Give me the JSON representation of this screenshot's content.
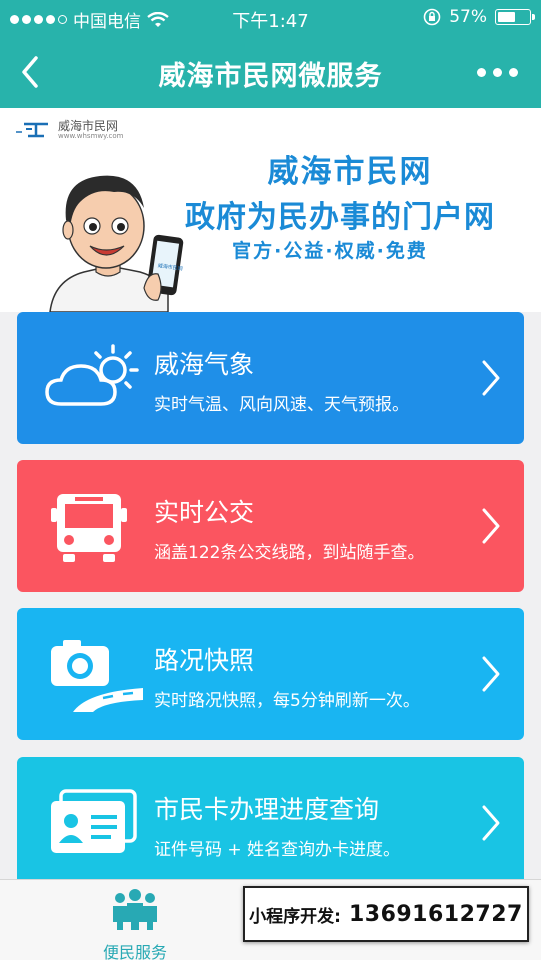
{
  "status_bar": {
    "carrier": "中国电信",
    "time": "下午1:47",
    "battery_percent": "57%",
    "battery_level": 0.57,
    "icons": [
      "signal-dots-icon",
      "wifi-icon",
      "rotation-lock-icon",
      "battery-icon"
    ]
  },
  "nav": {
    "title": "威海市民网微服务",
    "back_icon": "chevron-left-icon",
    "more_icon": "more-dots-icon"
  },
  "banner": {
    "logo_name": "威海市民网",
    "logo_url": "www.whsmwy.com",
    "title": "威海市民网",
    "subtitle": "政府为民办事的门户网",
    "tagline": "官方·公益·权威·免费",
    "phone_label": "威海市民网"
  },
  "services": [
    {
      "title": "威海气象",
      "desc": "实时气温、风向风速、天气预报。",
      "icon": "weather-cloud-sun-icon",
      "color": "#1f8fe8"
    },
    {
      "title": "实时公交",
      "desc": "涵盖122条公交线路，到站随手查。",
      "icon": "bus-icon",
      "color": "#fb5560"
    },
    {
      "title": "路况快照",
      "desc": "实时路况快照，每5分钟刷新一次。",
      "icon": "camera-road-icon",
      "color": "#19b5f2"
    },
    {
      "title": "市民卡办理进度查询",
      "desc": "证件号码 + 姓名查询办卡进度。",
      "icon": "id-card-icon",
      "color": "#19c4e4"
    }
  ],
  "tabbar": {
    "tabs": [
      {
        "label": "便民服务",
        "icon": "people-icon",
        "active": true
      },
      {
        "label": "",
        "icon": "",
        "active": false
      }
    ]
  },
  "promo": {
    "label": "小程序开发:",
    "phone": "13691612727"
  }
}
